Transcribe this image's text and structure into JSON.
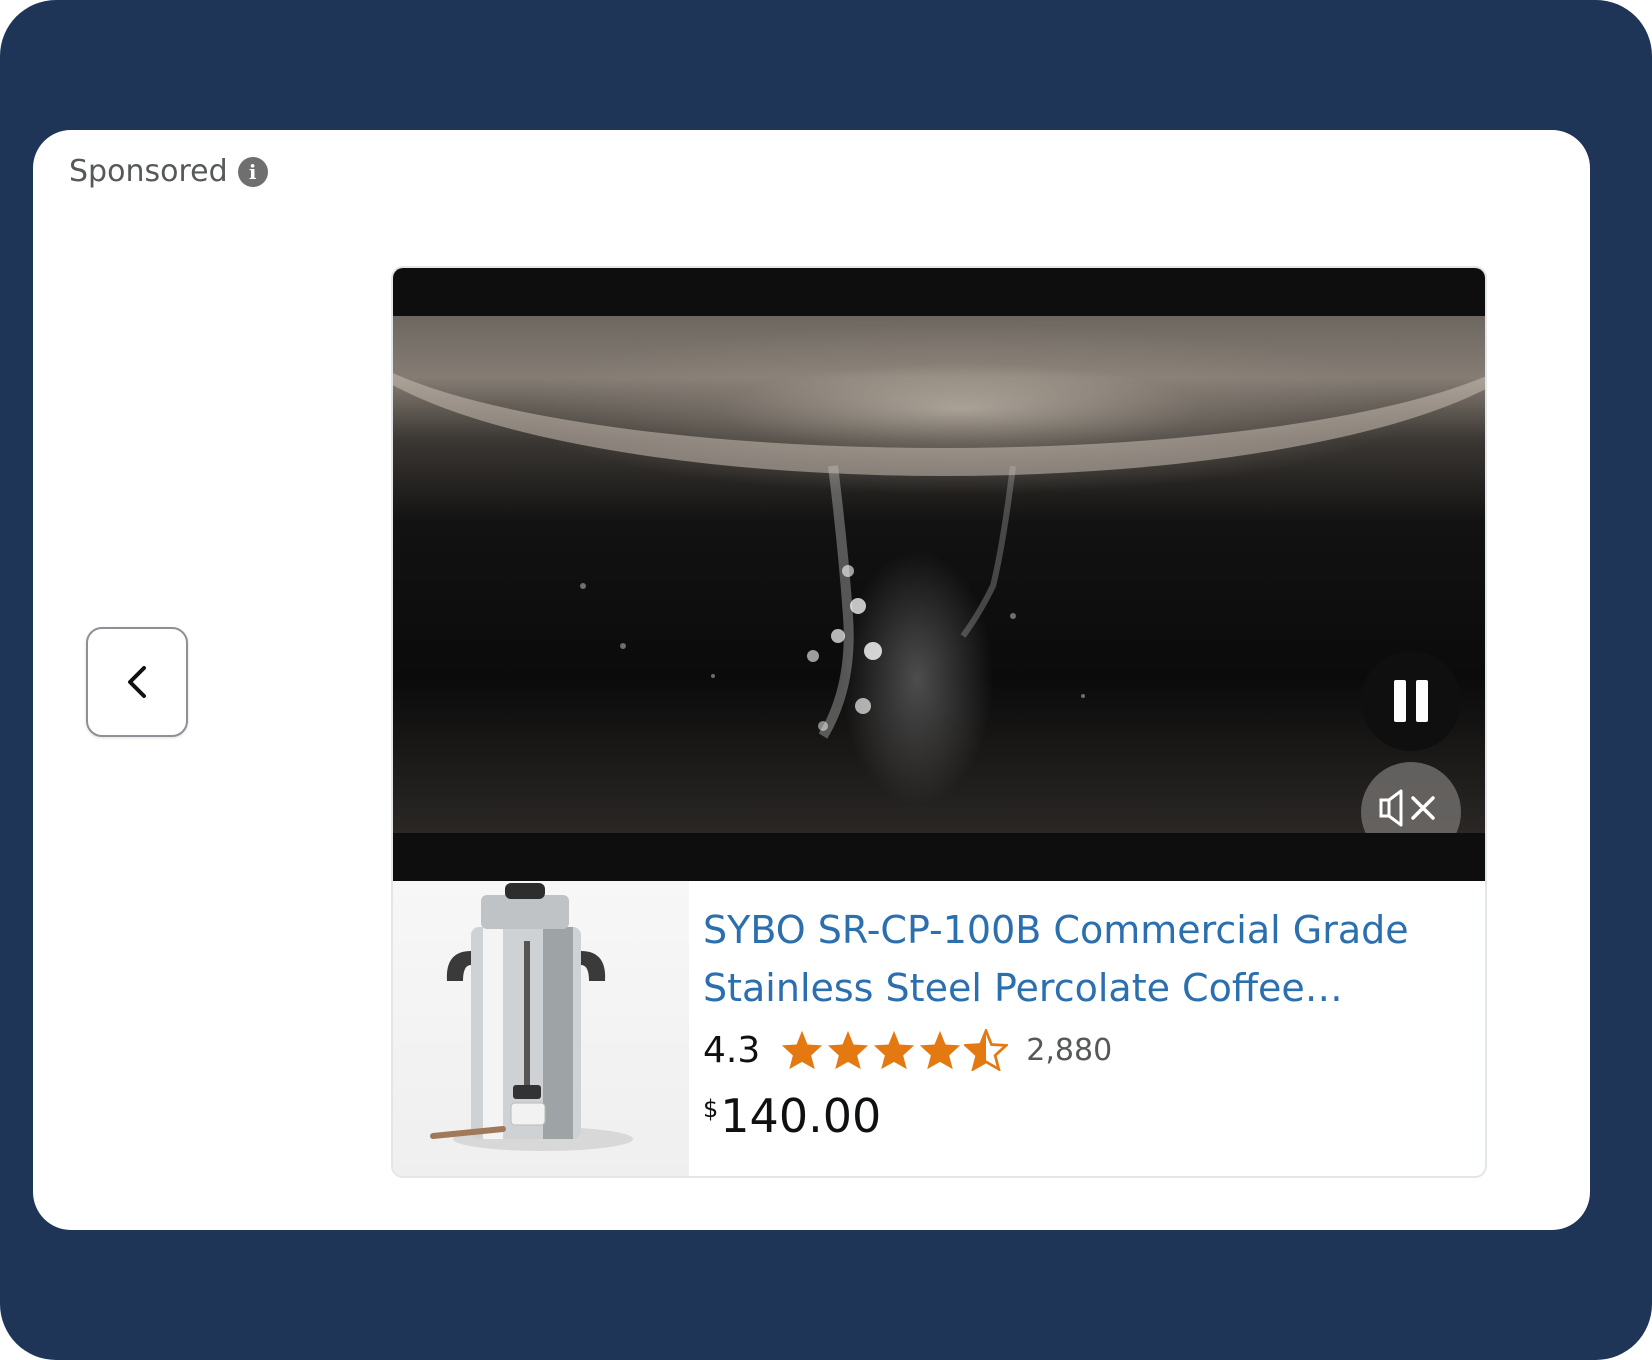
{
  "header": {
    "sponsored_label": "Sponsored",
    "info_icon_glyph": "i"
  },
  "navigation": {
    "prev_icon": "chevron-left-icon"
  },
  "video": {
    "pause_icon": "pause-icon",
    "mute_icon": "speaker-muted-icon"
  },
  "product": {
    "title": "SYBO SR-CP-100B Commercial Grade Stainless Steel Percolate Coffee Maker…",
    "rating": "4.3",
    "rating_stars": 4.3,
    "review_count": "2,880",
    "currency_symbol": "$",
    "price": "140.00"
  },
  "colors": {
    "frame_background": "#1e3557",
    "title_link": "#2b6fae",
    "star": "#e47911"
  }
}
